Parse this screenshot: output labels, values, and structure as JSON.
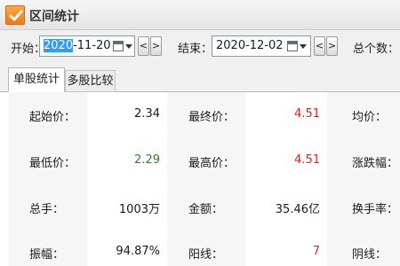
{
  "window": {
    "title": "区间统计"
  },
  "toolbar": {
    "start_label": "开始：",
    "start_date_selected": "2020",
    "start_date_rest": "-11-20",
    "end_label": "结束：",
    "end_date": "2020-12-02",
    "prev_label": "<",
    "next_label": ">",
    "total_label": "总个数："
  },
  "tabs": [
    {
      "label": "单股统计",
      "active": true
    },
    {
      "label": "多股比较",
      "active": false
    }
  ],
  "stats": {
    "rows": [
      [
        {
          "label": "起始价：",
          "value": "2.34"
        },
        {
          "label": "最终价：",
          "value": "4.51"
        },
        {
          "label": "均价："
        }
      ],
      [
        {
          "label": "最低价：",
          "value": "2.29"
        },
        {
          "label": "最高价：",
          "value": "4.51"
        },
        {
          "label": "涨跌幅："
        }
      ],
      [
        {
          "label": "总手：",
          "value": "1003万"
        },
        {
          "label": "金额：",
          "value": "35.46亿"
        },
        {
          "label": "换手率："
        }
      ],
      [
        {
          "label": "振幅：",
          "value": "94.87%"
        },
        {
          "label": "阳线：",
          "value": "7"
        },
        {
          "label": "阴线："
        }
      ]
    ]
  },
  "colors": {
    "up": "#e0201b",
    "down": "#1f8a1f",
    "accent": "#f07b12"
  },
  "icons": [
    "check-icon",
    "calendar-icon",
    "dropdown-icon"
  ]
}
